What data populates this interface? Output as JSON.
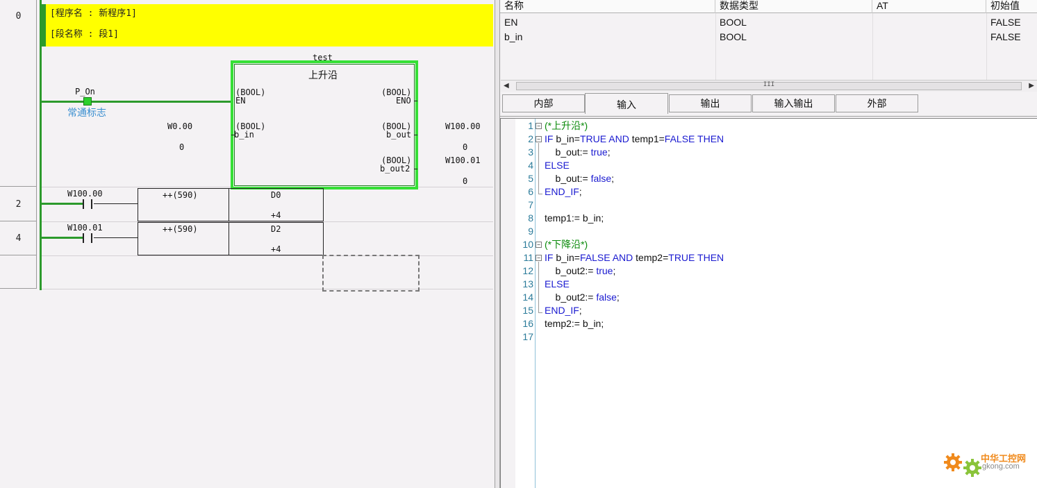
{
  "ladder": {
    "rung_numbers": [
      "0",
      "2",
      "4"
    ],
    "program_name_line": "[程序名 : 新程序1]",
    "section_name_line": "[段名称 : 段1]",
    "rung0": {
      "contact_label": "P_On",
      "contact_comment": "常通标志",
      "instance_name": "test",
      "fb_name": "上升沿",
      "input_pins": [
        {
          "type": "(BOOL)",
          "name": "EN"
        },
        {
          "type": "(BOOL)",
          "name": "b_in"
        }
      ],
      "output_pins": [
        {
          "type": "(BOOL)",
          "name": "ENO"
        },
        {
          "type": "(BOOL)",
          "name": "b_out"
        },
        {
          "type": "(BOOL)",
          "name": "b_out2"
        }
      ],
      "input_operand": "W0.00",
      "input_value": "0",
      "output1_operand": "W100.00",
      "output1_value": "0",
      "output2_operand": "W100.01",
      "output2_value": "0"
    },
    "rung2": {
      "contact_label": "W100.00",
      "instruction": "++(590)",
      "operand": "D0",
      "value": "+4"
    },
    "rung4": {
      "contact_label": "W100.01",
      "instruction": "++(590)",
      "operand": "D2",
      "value": "+4"
    }
  },
  "variables": {
    "columns": [
      "名称",
      "数据类型",
      "AT",
      "初始值"
    ],
    "rows": [
      {
        "name": "EN",
        "type": "BOOL",
        "at": "",
        "init": "FALSE"
      },
      {
        "name": "b_in",
        "type": "BOOL",
        "at": "",
        "init": "FALSE"
      }
    ],
    "scroll_grip": "III",
    "tabs": [
      "内部",
      "输入",
      "输出",
      "输入输出",
      "外部"
    ],
    "active_tab": "输入"
  },
  "st_code": {
    "line_numbers": [
      "1",
      "2",
      "3",
      "4",
      "5",
      "6",
      "7",
      "8",
      "9",
      "10",
      "11",
      "12",
      "13",
      "14",
      "15",
      "16",
      "17"
    ],
    "lines": [
      "(*上升沿*)",
      "IF b_in=TRUE AND temp1=FALSE THEN",
      "    b_out:= true;",
      "ELSE",
      "    b_out:= false;",
      "END_IF;",
      "",
      "temp1:= b_in;",
      "",
      "(*下降沿*)",
      "IF b_in=FALSE AND temp2=TRUE THEN",
      "    b_out2:= true;",
      "ELSE",
      "    b_out2:= false;",
      "END_IF;",
      "temp2:= b_in;",
      ""
    ]
  },
  "watermark": {
    "name": "中华工控网",
    "url": "gkong.com"
  },
  "colors": {
    "rail_green": "#2c9a2c",
    "fb_highlight": "#35e035",
    "header_yellow": "#ffff00",
    "keyword_blue": "#1a1ad0",
    "comment_green": "#0a8a0a"
  }
}
